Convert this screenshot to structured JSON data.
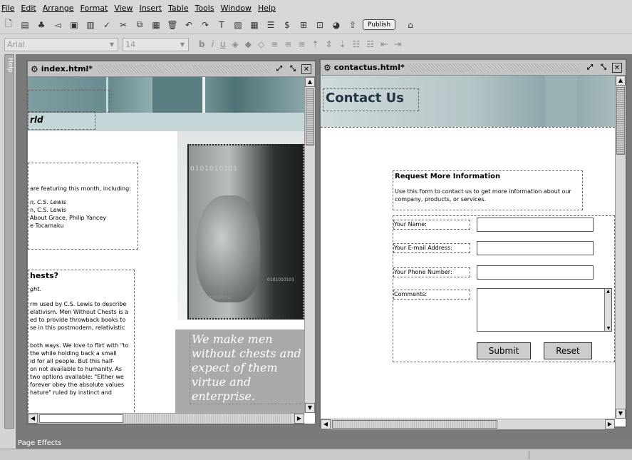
{
  "menu": [
    "File",
    "Edit",
    "Arrange",
    "Format",
    "View",
    "Insert",
    "Table",
    "Tools",
    "Window",
    "Help"
  ],
  "toolbar": {
    "publish_label": "Publish"
  },
  "format_bar": {
    "font": "Arial",
    "size": "14",
    "bold": "b",
    "italic": "i",
    "underline": "u"
  },
  "help_tab": "Help",
  "win1": {
    "title": "index.html*",
    "header_fragment": "rld",
    "box1": {
      "line1": "are featuring this month, including:",
      "line2": "n, C.S. Lewis",
      "line3": "n, C.S. Lewis",
      "line4": "About Grace, Philip Yancey",
      "line5": "e Tocamaku"
    },
    "heading2": "hests?",
    "sub2": "ght.",
    "para2a": [
      "rm used by C.S. Lewis to describe",
      "elativism. Men Without Chests is a",
      "ed to provide throwback books to",
      "se in this postmodern, relativistic"
    ],
    "para2b": [
      "both ways. We love to flirt with \"to",
      "the while holding back a small",
      "id for all people. But this half-",
      "on not available to humanity. As",
      "two options available: \"Either we",
      "forever obey the absolute values",
      "hature\" ruled by instinct and"
    ],
    "binary1": "0101010101",
    "binary2": "0101010101",
    "binary3": "0101010101",
    "quote": "We make men without chests and expect of them virtue and enterprise."
  },
  "win2": {
    "title": "contactus.html*",
    "page_title": "Contact Us",
    "form_heading": "Request More Information",
    "form_intro": "Use this form to contact us to get more information about our company, products, or services.",
    "labels": [
      "Your Name:",
      "Your E-mail Address:",
      "Your Phone Number:",
      "Comments:"
    ],
    "submit": "Submit",
    "reset": "Reset"
  },
  "page_effects": "Page Effects",
  "colors": {
    "workspace": "#7a7a7a",
    "quote_bg": "#a9a9a9",
    "header_teal": "#6f8e92"
  }
}
